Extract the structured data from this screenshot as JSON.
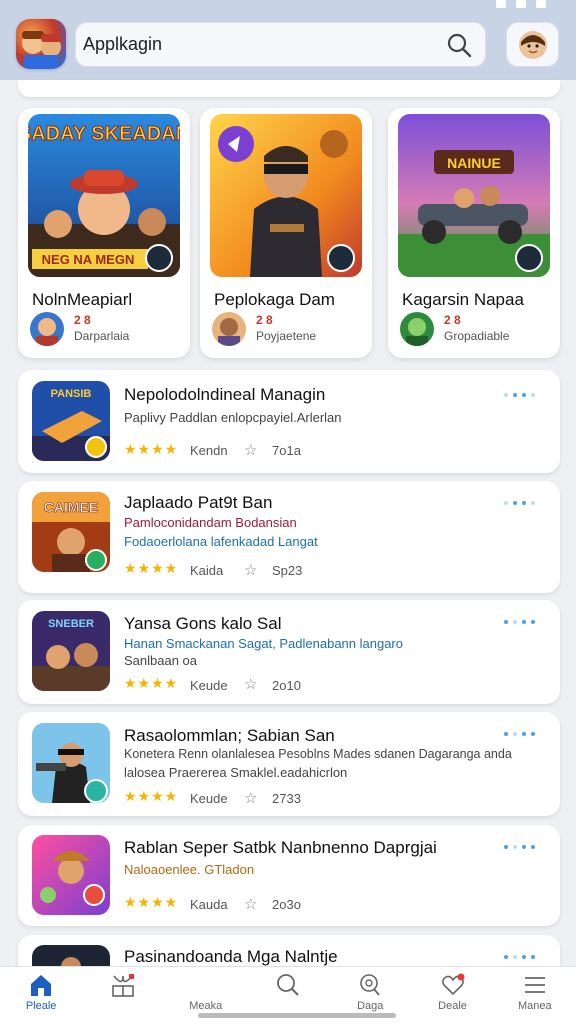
{
  "header": {
    "search_value": "Applkagin"
  },
  "featured": [
    {
      "title": "NolnMeapiarl",
      "rating": "2 8",
      "sub": "Darparlaia",
      "banner": "SADAY SKEADAN",
      "banner_sub": "NEG NA MEGN"
    },
    {
      "title": "Peplokaga Dam",
      "rating": "2 8",
      "sub": "Poyjaetene"
    },
    {
      "title": "Kagarsin Napaa",
      "rating": "2 8",
      "sub": "Gropadiable",
      "banner": "NAINUE"
    }
  ],
  "list": [
    {
      "title": "Nepolodolndineal Managin",
      "desc1": "Paplivy Paddlan enlopcpayiel.Arlerlan",
      "desc2": "",
      "meta1": "Kendn",
      "meta2": "7o1a",
      "thumb_label": "PANSIB"
    },
    {
      "title": "Japlaado Pat9t Ban",
      "desc1": "Pamloconidandam Bodansian",
      "desc2": "Fodaoerlolana lafenkadad Langat",
      "meta1": "Kaida",
      "meta2": "Sp23",
      "thumb_label": "CAIMEE"
    },
    {
      "title": "Yansa Gons kalo Sal",
      "desc1": "Hanan Smackanan Sagat, Padlenabann langaro",
      "desc2": "Sanlbaan oa",
      "meta1": "Keude",
      "meta2": "2o10",
      "thumb_label": "SNEBER"
    },
    {
      "title": "Rasaolommlan; Sabian San",
      "desc1": "Konetera Renn olanlalesea Pesoblns Mades sdanen Dagaranga anda",
      "desc2": "lalosea Praererea Smaklel.eadahicrlon",
      "meta1": "Keude",
      "meta2": "2733",
      "thumb_label": ""
    },
    {
      "title": "Rablan Seper Satbk Nanbnenno Daprgjai",
      "desc1": "Naloaoenlee. GTladon",
      "desc2": "",
      "meta1": "Kauda",
      "meta2": "2o3o",
      "thumb_label": ""
    },
    {
      "title": "Pasinandoanda Mga Nalntje",
      "desc1": "",
      "desc2": "",
      "meta1": "",
      "meta2": "",
      "thumb_label": ""
    }
  ],
  "stars": "★★★★",
  "nav": [
    {
      "label": "Pleale",
      "icon": "home-icon"
    },
    {
      "label": "",
      "icon": "library-icon"
    },
    {
      "label": "Meaka",
      "icon": "blank"
    },
    {
      "label": "",
      "icon": "search-icon"
    },
    {
      "label": "Daga",
      "icon": "magnify-chat-icon"
    },
    {
      "label": "Deale",
      "icon": "heart-icon"
    },
    {
      "label": "Manea",
      "icon": "menu-icon"
    }
  ],
  "colors": {
    "accent": "#1f5fbf",
    "header_bg": "#c9d3e6",
    "star": "#f4b400",
    "desc_red": "#9b1c3b",
    "desc_blue": "#1f6fae",
    "desc_gray": "#444444"
  }
}
